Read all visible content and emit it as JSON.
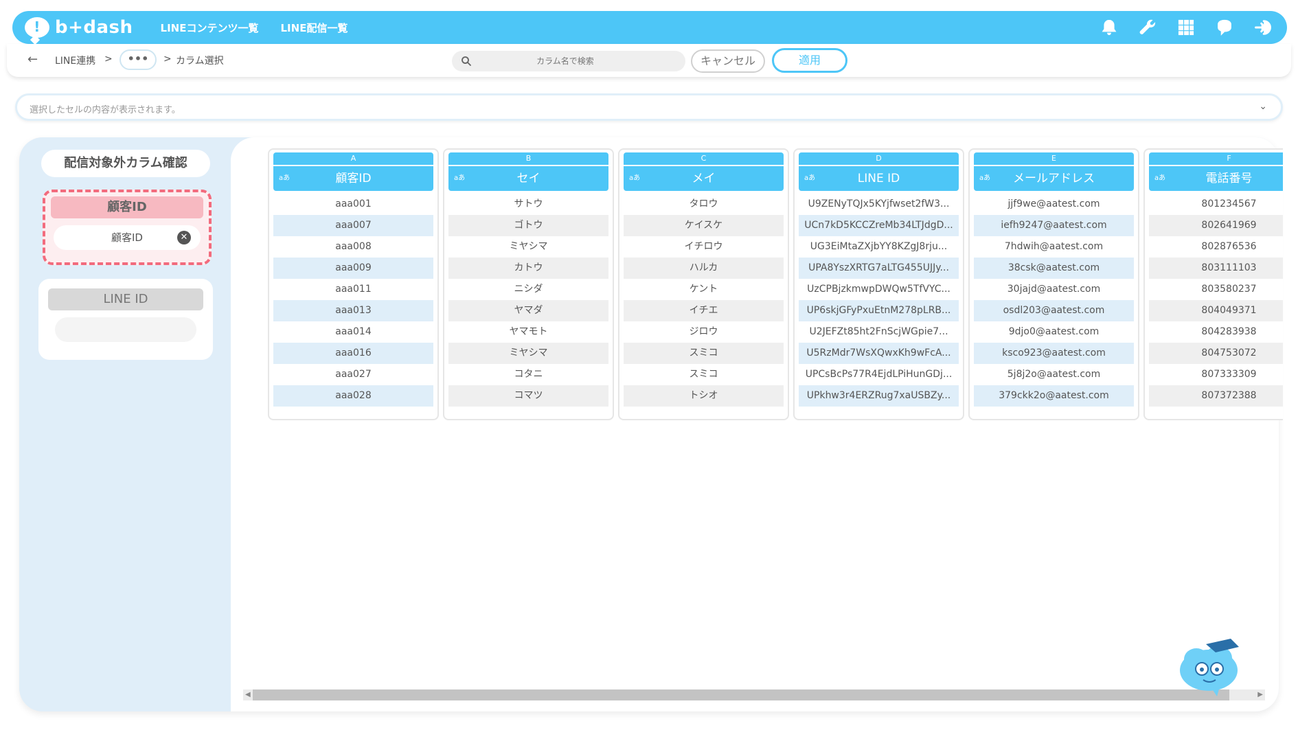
{
  "header": {
    "logo_text": "b+dash",
    "nav": [
      "LINEコンテンツ一覧",
      "LINE配信一覧"
    ],
    "icons": [
      "bell-icon",
      "wrench-icon",
      "grid-icon",
      "chat-bot-icon",
      "logout-icon"
    ]
  },
  "breadcrumb": {
    "item1": "LINE連携",
    "sep1": ">",
    "more": "•••",
    "sep2": ">",
    "current": "カラム選択"
  },
  "toolbar": {
    "search_placeholder": "カラム名で検索",
    "cancel_label": "キャンセル",
    "apply_label": "適用"
  },
  "cellbar": {
    "placeholder": "選択したセルの内容が表示されます。"
  },
  "left_panel": {
    "title": "配信対象外カラム確認",
    "excluded_card": {
      "header": "顧客ID",
      "chip": "顧客ID",
      "chip_remove": "✕"
    },
    "line_card": {
      "header": "LINE ID"
    }
  },
  "table": {
    "columns": [
      {
        "letter": "A",
        "type": "aあ",
        "name": "顧客ID",
        "rows": [
          "aaa001",
          "aaa007",
          "aaa008",
          "aaa009",
          "aaa011",
          "aaa013",
          "aaa014",
          "aaa016",
          "aaa027",
          "aaa028"
        ]
      },
      {
        "letter": "B",
        "type": "aあ",
        "name": "セイ",
        "rows": [
          "サトウ",
          "ゴトウ",
          "ミヤシマ",
          "カトウ",
          "ニシダ",
          "ヤマダ",
          "ヤマモト",
          "ミヤシマ",
          "コタニ",
          "コマツ"
        ]
      },
      {
        "letter": "C",
        "type": "aあ",
        "name": "メイ",
        "rows": [
          "タロウ",
          "ケイスケ",
          "イチロウ",
          "ハルカ",
          "ケント",
          "イチエ",
          "ジロウ",
          "スミコ",
          "スミコ",
          "トシオ"
        ]
      },
      {
        "letter": "D",
        "type": "aあ",
        "name": "LINE ID",
        "rows": [
          "U9ZENyTQJx5KYjfwset2fW3...",
          "UCn7kD5KCCZreMb34LTJdgD...",
          "UG3EiMtaZXjbYY8KZgJ8rju...",
          "UPA8YszXRTG7aLTG455UJJy...",
          "UzCPBjzkmwpDWQw5TfVYC...",
          "UP6skjGFyPxuEtnM278pLRB...",
          "U2JEFZt85ht2FnScjWGpie7...",
          "U5RzMdr7WsXQwxKh9wFcA...",
          "UPCsBcPs77R4EjdLPiHunGDj...",
          "UPkhw3r4ERZRug7xaUSBZy..."
        ]
      },
      {
        "letter": "E",
        "type": "aあ",
        "name": "メールアドレス",
        "rows": [
          "jjf9we@aatest.com",
          "iefh9247@aatest.com",
          "7hdwih@aatest.com",
          "38csk@aatest.com",
          "30jajd@aatest.com",
          "osdl203@aatest.com",
          "9djo0@aatest.com",
          "ksco923@aatest.com",
          "5j8j2o@aatest.com",
          "379ckk2o@aatest.com"
        ]
      },
      {
        "letter": "F",
        "type": "aあ",
        "name": "電話番号",
        "rows": [
          "801234567",
          "802641969",
          "802876536",
          "803111103",
          "803580237",
          "804049371",
          "804283938",
          "804753072",
          "807333309",
          "807372388"
        ]
      }
    ]
  },
  "scrollbar": {
    "left": "◀",
    "right": "▶"
  }
}
